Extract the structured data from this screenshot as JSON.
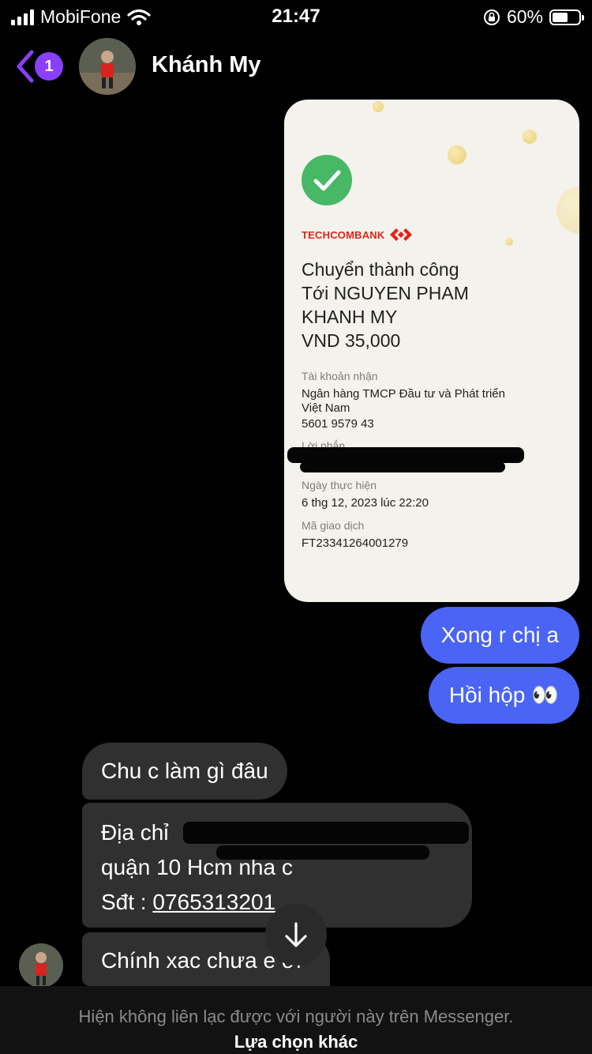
{
  "status_bar": {
    "carrier": "MobiFone",
    "time": "21:47",
    "battery_percent": "60%",
    "battery_level": 0.6
  },
  "header": {
    "back_count": "1",
    "contact_name": "Khánh My"
  },
  "receipt": {
    "bank_name": "TECHCOMBANK",
    "title_lines": [
      "Chuyển thành công",
      "Tới NGUYEN PHAM",
      "KHANH MY",
      "VND 35,000"
    ],
    "account_label": "Tài khoản nhận",
    "account_bank_lines": [
      "Ngân hàng TMCP Đầu tư và Phát triển",
      "Việt Nam"
    ],
    "account_number": "5601 9579 43",
    "message_label": "Lời nhắn",
    "date_label": "Ngày thực hiện",
    "date_value": "6 thg 12, 2023 lúc 22:20",
    "txn_label": "Mã giao dịch",
    "txn_value": "FT23341264001279"
  },
  "messages": {
    "out_1": "Xong r chị a",
    "out_2": "Hồi hộp 👀",
    "in_1": "Chu c làm gì đâu",
    "in_2_line1": "Địa chỉ",
    "in_2_line2": "quận 10 Hcm nha c",
    "in_2_line3_prefix": "Sđt : ",
    "in_2_phone": "0765313201",
    "in_3": "Chính xac chưa e ơi"
  },
  "footer": {
    "message": "Hiện không liên lạc được với người này trên Messenger.",
    "link": "Lựa chọn khác"
  },
  "colors": {
    "accent": "#4a64f5",
    "badge": "#8a3ffc",
    "incoming": "#303030",
    "success": "#47b865",
    "bank_red": "#e2231a"
  },
  "icons": [
    "signal-icon",
    "wifi-icon",
    "lock-rotation-icon",
    "battery-icon",
    "back-chevron-icon",
    "checkmark-icon",
    "techcombank-logo-icon",
    "arrow-down-icon"
  ]
}
